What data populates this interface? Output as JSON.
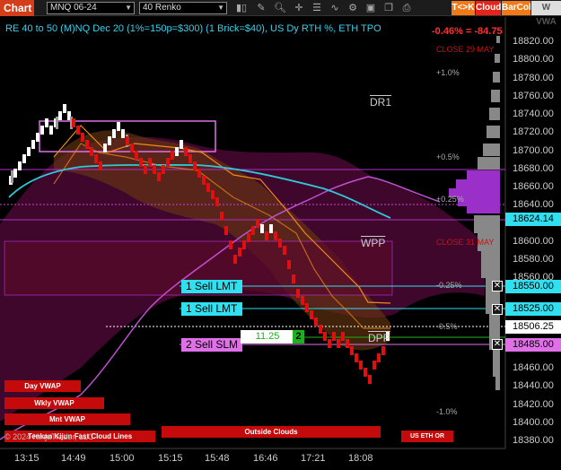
{
  "toolbar": {
    "chart_tab": "Chart",
    "symbol": "MNQ 06-24",
    "bar_type": "40 Renko",
    "icons": [
      "bar-style-icon",
      "draw-icon",
      "zoom-icon",
      "crosshair-icon",
      "properties-icon",
      "indicators-icon",
      "strategies-icon",
      "save-icon",
      "copy-icon",
      "print-icon"
    ],
    "tk_label": "T<>K",
    "cloud_label": "Cloud",
    "barcol_label": "BarCol",
    "vwap_label": "W VWA"
  },
  "chart": {
    "title": "RE 40 to 50 (M)NQ Dec 20 (1%=150p=$300) (1 Brick=$40), US Dy RTH %, ETH TPO",
    "pct_change": "-0.46% = -84.75",
    "close_29_may": "CLOSE 29 MAY",
    "close_31_may": "CLOSE 31 MAY",
    "pct_levels": [
      "+1.0%",
      "+0.5%",
      "+0.25%",
      "-0.25%",
      "-0.5%",
      "-1.0%"
    ],
    "levels": {
      "dr1": "DR1",
      "wpp": "WPP",
      "dpp": "DPP"
    },
    "y_axis": [
      "18820.00",
      "18800.00",
      "18780.00",
      "18760.00",
      "18740.00",
      "18720.00",
      "18700.00",
      "18680.00",
      "18660.00",
      "18640.00",
      "18620.00",
      "18600.00",
      "18580.00",
      "18560.00",
      "18540.00",
      "18520.00",
      "18500.00",
      "18480.00",
      "18460.00",
      "18440.00",
      "18420.00",
      "18400.00",
      "18380.00"
    ],
    "x_axis": [
      "13:15",
      "14:49",
      "15:00",
      "15:15",
      "15:48",
      "16:46",
      "17:21",
      "18:08"
    ],
    "price_tags": [
      {
        "value": "18624.14",
        "color": "#2ee0f0"
      },
      {
        "value": "18550.00",
        "color": "#2ee0f0"
      },
      {
        "value": "18525.00",
        "color": "#2ee0f0"
      },
      {
        "value": "18506.25",
        "color": "#ffffff"
      },
      {
        "value": "18485.00",
        "color": "#e070e8"
      }
    ],
    "orders": {
      "sell1": "1 Sell LMT",
      "sell2": "1 Sell LMT",
      "slm": "2 Sell SLM",
      "pnl": "11.25",
      "qty": "2"
    },
    "vwap_buttons": [
      "Day VWAP",
      "Wkly VWAP",
      "Mnt VWAP",
      "Tenkan Kijun Fast Cloud Lines",
      "Outside Clouds",
      "US ETH OR"
    ],
    "copyright": "© 2024 NinjaTrader, LLC"
  },
  "colors": {
    "brick_up": "#ffffff",
    "brick_down": "#e01010",
    "cloud": "#5a0a3a",
    "teal_line": "#30c8d8",
    "orange_line": "#f08a18",
    "profile": "#9a30c8"
  }
}
